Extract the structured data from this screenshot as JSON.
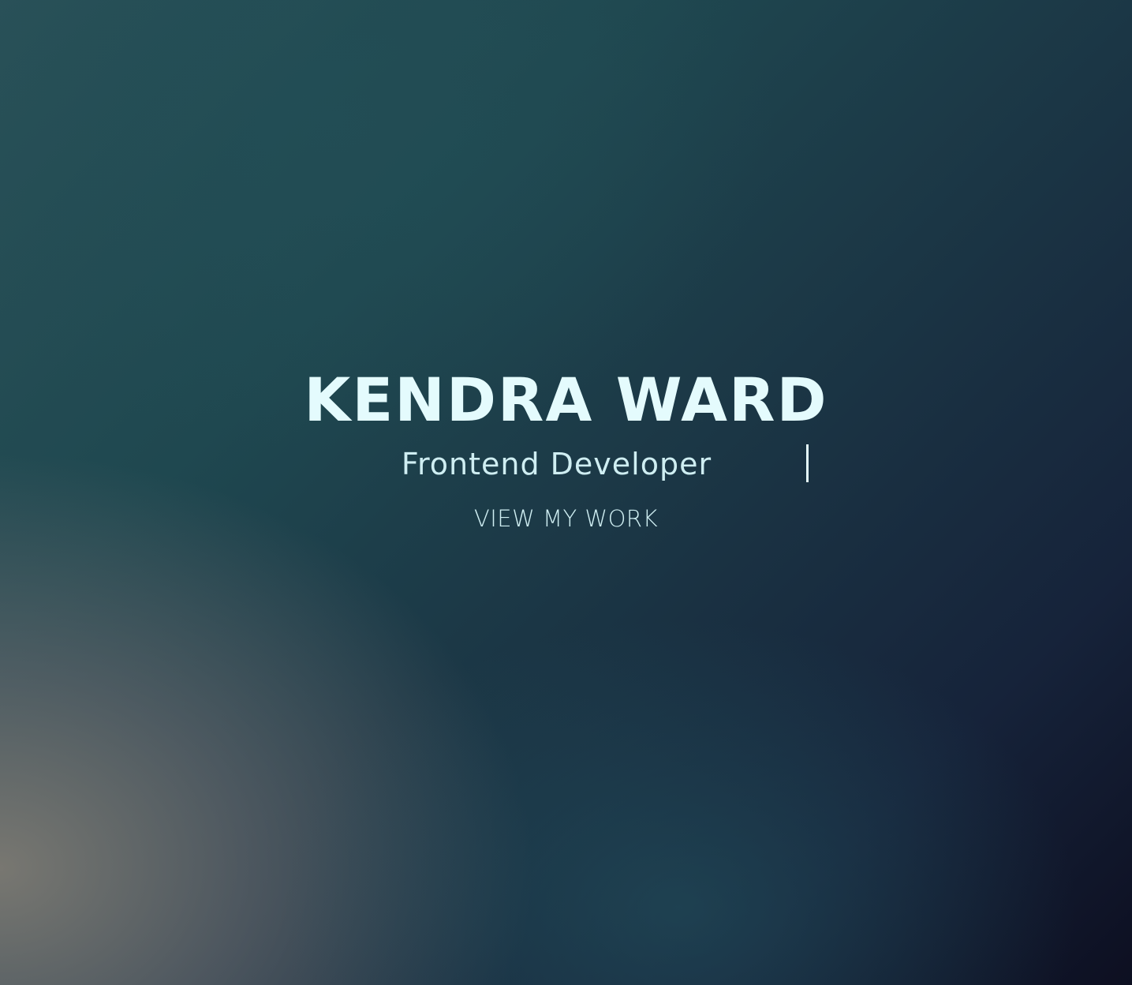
{
  "hero": {
    "name": "KENDRA WARD",
    "subtitle": "Frontend Developer",
    "cta_label": "VIEW MY WORK"
  },
  "colors": {
    "heading": "#e4fbfd",
    "text": "#cfeef2",
    "bg_dark": "#0d0f21",
    "bg_teal": "#1f4850",
    "bg_gray": "#7d7a73"
  }
}
